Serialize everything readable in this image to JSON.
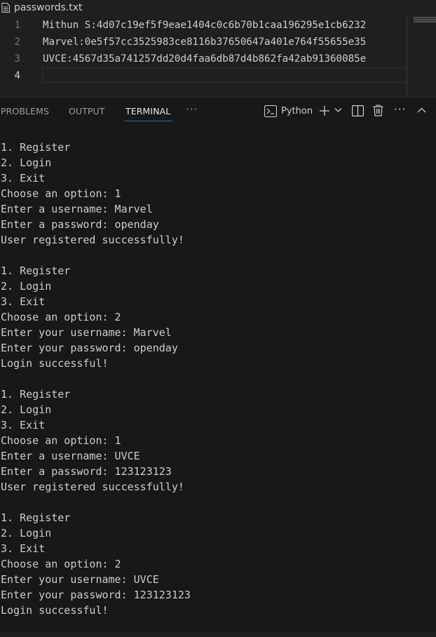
{
  "editor": {
    "tab_name": "passwords.txt",
    "lines": [
      {
        "num": "1",
        "text": "Mithun S:4d07c19ef5f9eae1404c0c6b70b1caa196295e1cb6232"
      },
      {
        "num": "2",
        "text": "Marvel:0e5f57cc3525983ce8116b37650647a401e764f55655e35"
      },
      {
        "num": "3",
        "text": "UVCE:4567d35a741257dd20d4faa6db87d4b862fa42ab91360085e"
      },
      {
        "num": "4",
        "text": ""
      }
    ]
  },
  "panel": {
    "tabs": [
      {
        "label": "PROBLEMS"
      },
      {
        "label": "OUTPUT"
      },
      {
        "label": "TERMINAL"
      }
    ],
    "more_label": "···",
    "python_label": "Python",
    "actions_more": "···"
  },
  "terminal": {
    "lines": [
      "1. Register",
      "2. Login",
      "3. Exit",
      "Choose an option: 1",
      "Enter a username: Marvel",
      "Enter a password: openday",
      "User registered successfully!",
      "",
      "1. Register",
      "2. Login",
      "3. Exit",
      "Choose an option: 2",
      "Enter your username: Marvel",
      "Enter your password: openday",
      "Login successful!",
      "",
      "1. Register",
      "2. Login",
      "3. Exit",
      "Choose an option: 1",
      "Enter a username: UVCE",
      "Enter a password: 123123123",
      "User registered successfully!",
      "",
      "1. Register",
      "2. Login",
      "3. Exit",
      "Choose an option: 2",
      "Enter your username: UVCE",
      "Enter your password: 123123123",
      "Login successful!"
    ]
  },
  "icons": {
    "file": "file-lines-icon",
    "terminal": "terminal-icon",
    "add": "plus-icon",
    "chevron": "chevron-down-icon",
    "split": "split-terminal-icon",
    "trash": "trash-icon",
    "more": "more-actions-icon",
    "maximize": "chevron-up-icon"
  },
  "colors": {
    "accent": "#0078d4",
    "text": "#cccccc",
    "background": "#181818"
  }
}
